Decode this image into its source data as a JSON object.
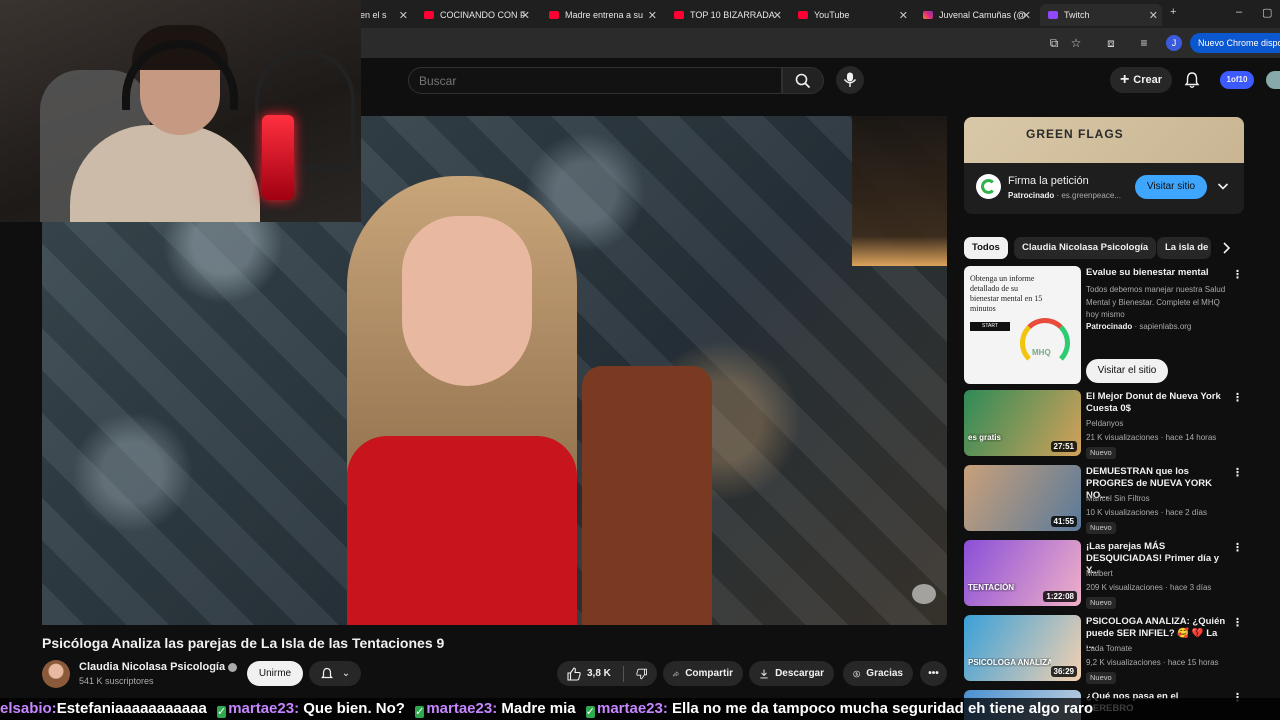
{
  "browser": {
    "tabs": [
      {
        "label": "en el s",
        "favicon": "none"
      },
      {
        "label": "COCINANDO CON F",
        "favicon": "youtube"
      },
      {
        "label": "Madre entrena a su",
        "favicon": "youtube"
      },
      {
        "label": "TOP 10 BIZARRADA",
        "favicon": "youtube"
      },
      {
        "label": "YouTube",
        "favicon": "youtube"
      },
      {
        "label": "Juvenal Camuñas (@",
        "favicon": "instagram"
      },
      {
        "label": "Twitch",
        "favicon": "twitch"
      }
    ],
    "profile_initial": "J",
    "update_label": "Nuevo Chrome dispon"
  },
  "youtube_header": {
    "search_placeholder": "Buscar",
    "create_label": "Crear",
    "avatar_label": "1of10"
  },
  "video": {
    "title": "Psicóloga Analiza las parejas de La Isla de las Tentaciones 9",
    "channel_name": "Claudia Nicolasa Psicología",
    "subscribers": "541 K suscriptores",
    "join_label": "Unirme",
    "likes": "3,8 K",
    "share_label": "Compartir",
    "download_label": "Descargar",
    "thanks_label": "Gracias"
  },
  "ad_card": {
    "banner_text": "GREEN FLAGS",
    "title": "Firma la petición",
    "sponsor_label": "Patrocinado",
    "domain": "es.greenpeace...",
    "button_label": "Visitar sitio"
  },
  "chips": [
    "Todos",
    "Claudia Nicolasa Psicología",
    "La isla de"
  ],
  "sponsored_rec": {
    "thumb_text": "Obtenga un informe detallado de su bienestar mental en 15 minutos",
    "thumb_start": "START",
    "thumb_logo": "MHQ",
    "title": "Evalue su bienestar mental",
    "description": "Todos debemos manejar nuestra Salud Mental y Bienestar. Complete el MHQ hoy mismo",
    "sponsor_label": "Patrocinado",
    "domain": "sapienlabs.org",
    "button_label": "Visitar el sitio"
  },
  "recommendations": [
    {
      "title": "El Mejor Donut de Nueva York Cuesta 0$",
      "channel": "Peldanyos",
      "stats": "21 K visualizaciones · hace 14 horas",
      "badge": "Nuevo",
      "duration": "27:51",
      "thumb_text": "es gratis",
      "color_a": "#2e8b57",
      "color_b": "#d4a15a"
    },
    {
      "title": "DEMUESTRAN que los PROGRES de NUEVA YORK NO...",
      "channel": "Maricel Sin Filtros",
      "stats": "10 K visualizaciones · hace 2 días",
      "badge": "Nuevo",
      "duration": "41:55",
      "thumb_text": "",
      "color_a": "#c9a07a",
      "color_b": "#5a7a9a"
    },
    {
      "title": "¡Las parejas MÁS DESQUICIADAS! Primer día y Y...",
      "channel": "Malbert",
      "stats": "209 K visualizaciones · hace 3 días",
      "badge": "Nuevo",
      "duration": "1:22:08",
      "thumb_text": "TENTACIÓN",
      "color_a": "#8a4fd8",
      "color_b": "#f0b0c8"
    },
    {
      "title": "PSICOLOGA ANALIZA: ¿Quién puede SER INFIEL? 🥰 💔 La ...",
      "channel": "Lada Tomate",
      "stats": "9,2 K visualizaciones · hace 15 horas",
      "badge": "Nuevo",
      "duration": "36:29",
      "thumb_text": "PSICOLOGA ANALIZA PAREJAS DE LA I",
      "color_a": "#3aa0d8",
      "color_b": "#f4d0b0"
    },
    {
      "title": "¿Qué nos pasa en el CEREBRO",
      "channel": "",
      "stats": "",
      "badge": "",
      "duration": "",
      "thumb_text": "",
      "color_a": "#4a90d0",
      "color_b": "#d0d8e0"
    }
  ],
  "chat": {
    "messages": [
      {
        "user": "elsabio:",
        "text": "Estefaniaaaaaaaaaaa"
      },
      {
        "user": "martae23:",
        "text": "Que bien. No?"
      },
      {
        "user": "martae23:",
        "text": "Madre mia"
      },
      {
        "user": "martae23:",
        "text": "Ella no me da tampoco mucha seguridad eh tiene algo raro"
      }
    ]
  },
  "colors": {
    "background": "#0f0f0f",
    "youtube_red": "#ff0033",
    "link_blue": "#3ea6ff",
    "chat_user": "#c586ff"
  }
}
